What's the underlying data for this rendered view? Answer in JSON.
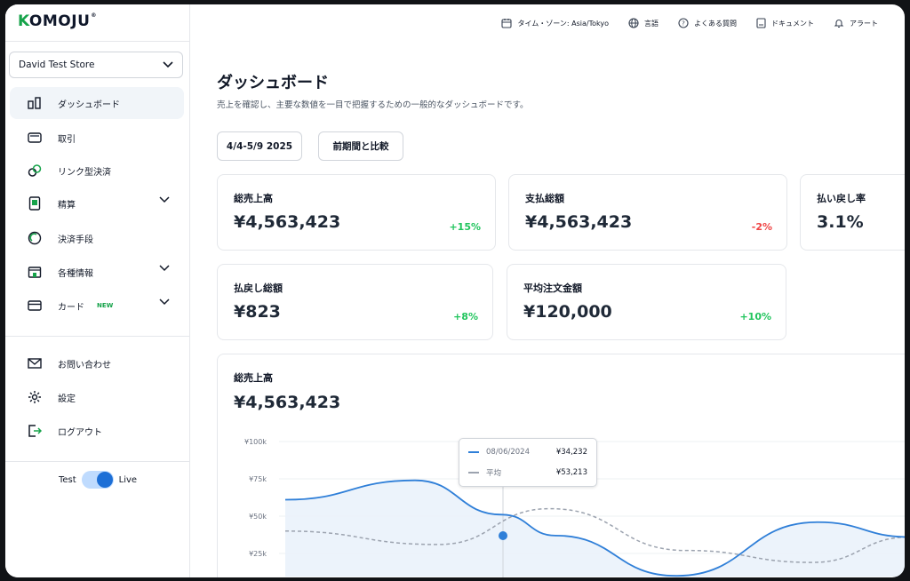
{
  "brand": {
    "logo_text_a": "K",
    "logo_text_b": "OMOJU",
    "logo_tm": "®"
  },
  "sidebar": {
    "store": "David Test Store",
    "items": [
      {
        "label": "ダッシュボード",
        "icon": "dashboard-icon",
        "active": true
      },
      {
        "label": "取引",
        "icon": "wallet-icon"
      },
      {
        "label": "リンク型決済",
        "icon": "link-icon"
      },
      {
        "label": "精算",
        "icon": "receipt-icon",
        "expandable": true
      },
      {
        "label": "決済手段",
        "icon": "payment-method-icon"
      },
      {
        "label": "各種情報",
        "icon": "store-icon",
        "expandable": true
      },
      {
        "label": "カード",
        "icon": "card-icon",
        "badge": "NEW",
        "expandable": true
      }
    ],
    "bottom_items": [
      {
        "label": "お問い合わせ",
        "icon": "mail-icon"
      },
      {
        "label": "設定",
        "icon": "gear-icon"
      },
      {
        "label": "ログアウト",
        "icon": "logout-icon"
      }
    ],
    "mode_test": "Test",
    "mode_live": "Live",
    "live_enabled": true
  },
  "topbar": {
    "timezone": "タイム・ゾーン: Asia/Tokyo",
    "language": "言語",
    "faq": "よくある質問",
    "docs": "ドキュメント",
    "alerts": "アラート"
  },
  "main": {
    "title": "ダッシュボード",
    "subtitle": "売上を確認し、主要な数値を一目で把握するための一般的なダッシュボードです。",
    "date_range": "4/4-5/9 2025",
    "compare_label": "前期間と比較"
  },
  "kpis": [
    {
      "label": "総売上高",
      "value": "¥4,563,423",
      "delta": "+15%",
      "trend": "positive"
    },
    {
      "label": "支払総額",
      "value": "¥4,563,423",
      "delta": "-2%",
      "trend": "negative"
    },
    {
      "label": "払い戻し率",
      "value": "3.1%",
      "delta": "",
      "trend": ""
    },
    {
      "label": "払戻し総額",
      "value": "¥823",
      "delta": "+8%",
      "trend": "positive"
    },
    {
      "label": "平均注文金額",
      "value": "¥120,000",
      "delta": "+10%",
      "trend": "positive"
    }
  ],
  "chart_data": {
    "type": "line",
    "title": "総売上高",
    "total": "¥4,563,423",
    "y_ticks": [
      "¥100k",
      "¥75k",
      "¥50k",
      "¥25k"
    ],
    "ylim": [
      0,
      100000
    ],
    "series": [
      {
        "values": [
          61000,
          74000,
          51000,
          37000,
          10000,
          46000,
          36000
        ]
      },
      {
        "name": "平均",
        "values": [
          40000,
          31000,
          55000,
          27000,
          19000,
          36000
        ]
      }
    ],
    "tooltip": {
      "date": "08/06/2024",
      "value": "¥34,232",
      "avg_label": "平均",
      "avg_value": "¥53,213"
    },
    "colors": {
      "primary": "#2f7fd8",
      "average": "#9ca3af"
    }
  }
}
